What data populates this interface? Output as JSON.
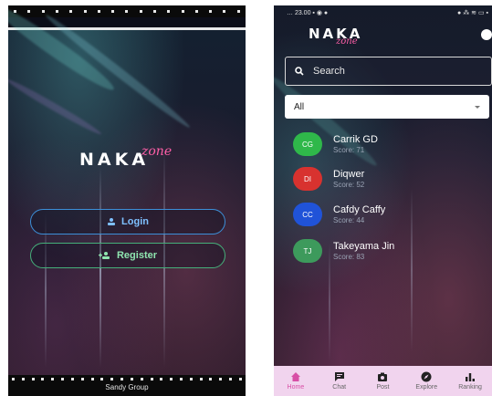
{
  "left_screen": {
    "logo": {
      "main": "NAKA",
      "script": "zone"
    },
    "buttons": {
      "login": "Login",
      "register": "Register"
    },
    "footer": "Sandy Group"
  },
  "right_screen": {
    "status_bar": {
      "time": "23.00"
    },
    "logo": {
      "main": "NAKA",
      "script": "zone"
    },
    "search": {
      "placeholder": "Search"
    },
    "filter": {
      "selected": "All"
    },
    "users": [
      {
        "initials": "CG",
        "name": "Carrik GD",
        "score_text": "Score: 71",
        "color": "#2fb84a"
      },
      {
        "initials": "DI",
        "name": "Diqwer",
        "score_text": "Score: 52",
        "color": "#d8322f"
      },
      {
        "initials": "CC",
        "name": "Cafdy Caffy",
        "score_text": "Score: 44",
        "color": "#2053d8"
      },
      {
        "initials": "TJ",
        "name": "Takeyama Jin",
        "score_text": "Score: 83",
        "color": "#3d9a5c"
      }
    ],
    "nav": [
      {
        "label": "Home",
        "icon": "home-icon",
        "active": true
      },
      {
        "label": "Chat",
        "icon": "chat-icon",
        "active": false
      },
      {
        "label": "Post",
        "icon": "camera-icon",
        "active": false
      },
      {
        "label": "Explore",
        "icon": "compass-icon",
        "active": false
      },
      {
        "label": "Ranking",
        "icon": "ranking-icon",
        "active": false
      }
    ]
  },
  "colors": {
    "login_accent": "#3c8fd8",
    "register_accent": "#45b07a",
    "nav_background": "#f1d4ee",
    "nav_active": "#d84fa6"
  }
}
